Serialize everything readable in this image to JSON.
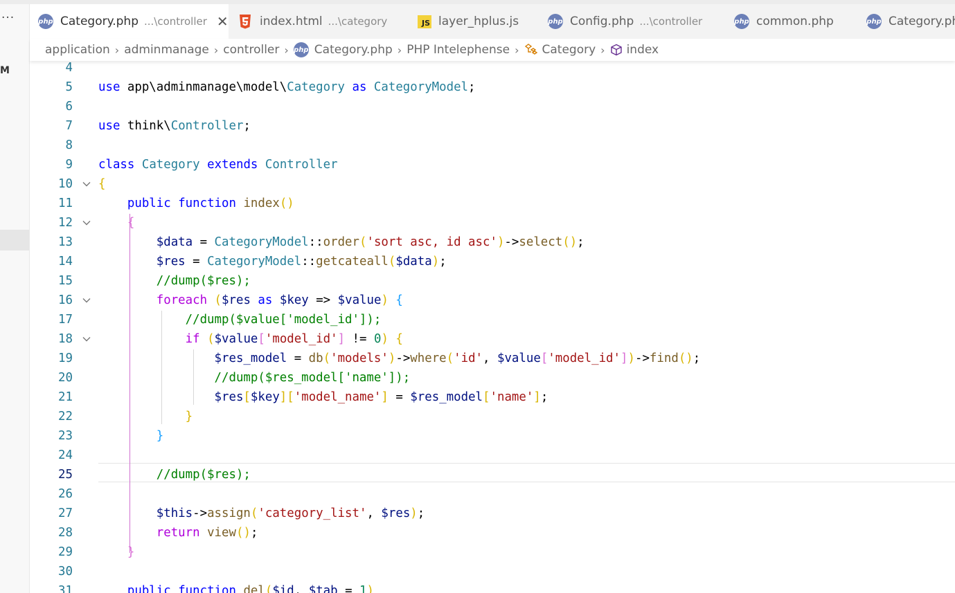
{
  "sidebar": {
    "more_label": "···",
    "letter": "M"
  },
  "tabs": [
    {
      "name": "Category.php",
      "desc": "...\\controller",
      "icon": "php-icon",
      "active": true,
      "close": "✕"
    },
    {
      "name": "index.html",
      "desc": "...\\category",
      "icon": "html5-icon"
    },
    {
      "name": "layer_hplus.js",
      "desc": "",
      "icon": "js-icon",
      "icon_text": "JS"
    },
    {
      "name": "Config.php",
      "desc": "...\\controller",
      "icon": "php-icon"
    },
    {
      "name": "common.php",
      "desc": "",
      "icon": "php-icon"
    },
    {
      "name": "Category.ph",
      "desc": "",
      "icon": "php-icon"
    }
  ],
  "php_icon_text": "php",
  "breadcrumbs": {
    "items": [
      "application",
      "adminmanage",
      "controller",
      "Category.php",
      "PHP Intelephense",
      "Category",
      "index"
    ],
    "separator": "›"
  },
  "editor": {
    "current_line": 25,
    "lines": [
      {
        "n": "4",
        "text": ""
      },
      {
        "n": "5",
        "text": "use app\\adminmanage\\model\\Category as CategoryModel;"
      },
      {
        "n": "6",
        "text": ""
      },
      {
        "n": "7",
        "text": "use think\\Controller;"
      },
      {
        "n": "8",
        "text": ""
      },
      {
        "n": "9",
        "text": "class Category extends Controller"
      },
      {
        "n": "10",
        "text": "{"
      },
      {
        "n": "11",
        "text": "    public function index()"
      },
      {
        "n": "12",
        "text": "    {"
      },
      {
        "n": "13",
        "text": "        $data = CategoryModel::order('sort asc, id asc')->select();"
      },
      {
        "n": "14",
        "text": "        $res = CategoryModel::getcateall($data);"
      },
      {
        "n": "15",
        "text": "        //dump($res);"
      },
      {
        "n": "16",
        "text": "        foreach ($res as $key => $value) {"
      },
      {
        "n": "17",
        "text": "            //dump($value['model_id']);"
      },
      {
        "n": "18",
        "text": "            if ($value['model_id'] != 0) {"
      },
      {
        "n": "19",
        "text": "                $res_model = db('models')->where('id', $value['model_id'])->find();"
      },
      {
        "n": "20",
        "text": "                //dump($res_model['name']);"
      },
      {
        "n": "21",
        "text": "                $res[$key]['model_name'] = $res_model['name'];"
      },
      {
        "n": "22",
        "text": "            }"
      },
      {
        "n": "23",
        "text": "        }"
      },
      {
        "n": "24",
        "text": ""
      },
      {
        "n": "25",
        "text": "        //dump($res);"
      },
      {
        "n": "26",
        "text": ""
      },
      {
        "n": "27",
        "text": "        $this->assign('category_list', $res);"
      },
      {
        "n": "28",
        "text": "        return view();"
      },
      {
        "n": "29",
        "text": "    }"
      },
      {
        "n": "30",
        "text": ""
      },
      {
        "n": "31",
        "text": "    public function del($id, $tab = 1)"
      }
    ],
    "folded_lines": [
      "10",
      "12",
      "16",
      "18"
    ]
  },
  "colors": {
    "keyword": "#0000ff",
    "control": "#af00db",
    "type": "#267f99",
    "function": "#795e26",
    "variable": "#001080",
    "string": "#a31515",
    "comment": "#008000",
    "number": "#098658",
    "line_number": "#237893"
  }
}
